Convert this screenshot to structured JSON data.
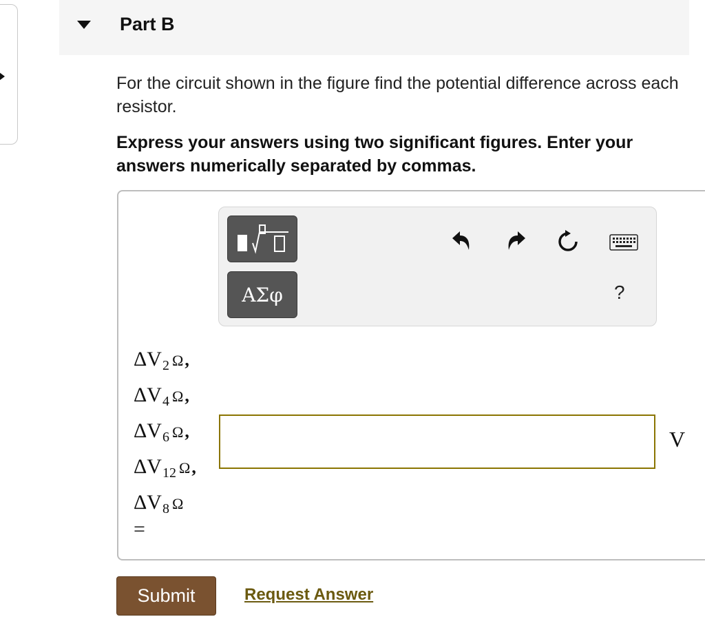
{
  "part": {
    "title": "Part B"
  },
  "question": {
    "text": "For the circuit shown in the figure find the potential difference across each resistor.",
    "instruction": "Express your answers using two significant figures. Enter your answers numerically separated by commas."
  },
  "toolbar": {
    "symbols_label": "ΑΣφ",
    "help_label": "?",
    "icons": [
      "templates-icon",
      "undo-icon",
      "redo-icon",
      "reset-icon",
      "keyboard-icon",
      "help-icon"
    ]
  },
  "answer": {
    "labels": [
      {
        "prefix": "ΔV",
        "sub": "2",
        "unit": "Ω",
        "sep": ","
      },
      {
        "prefix": "ΔV",
        "sub": "4",
        "unit": "Ω",
        "sep": ","
      },
      {
        "prefix": "ΔV",
        "sub": "6",
        "unit": "Ω",
        "sep": ","
      },
      {
        "prefix": "ΔV",
        "sub": "12",
        "unit": "Ω",
        "sep": ","
      },
      {
        "prefix": "ΔV",
        "sub": "8",
        "unit": "Ω",
        "sep": ""
      }
    ],
    "equals": "=",
    "value": "",
    "unit": "V"
  },
  "actions": {
    "submit_label": "Submit",
    "request_label": "Request Answer"
  },
  "colors": {
    "submit_bg": "#7a5230",
    "link": "#6b5a10",
    "input_border": "#8a7400"
  }
}
